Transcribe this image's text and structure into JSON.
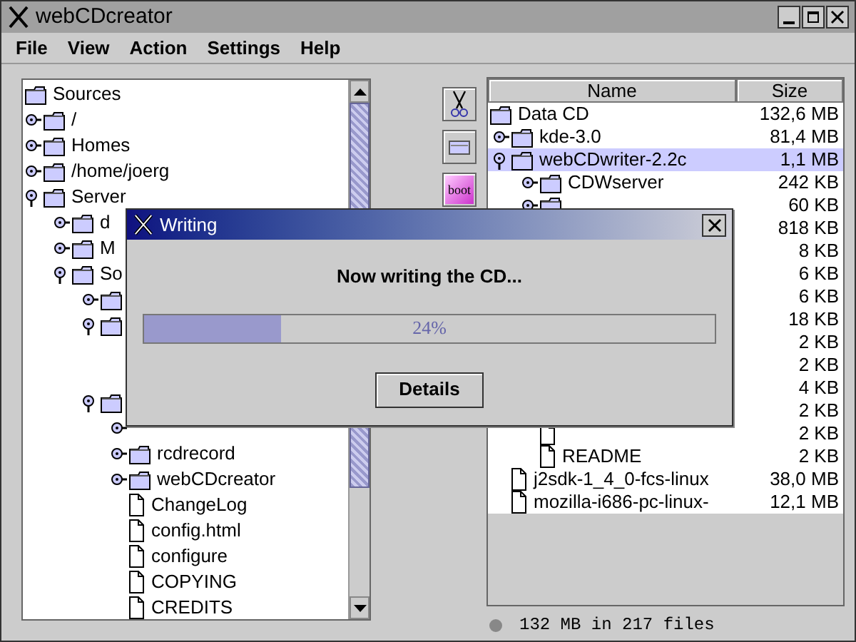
{
  "window": {
    "title": "webCDcreator"
  },
  "menu": [
    "File",
    "View",
    "Action",
    "Settings",
    "Help"
  ],
  "source_tree": [
    {
      "kind": "folder",
      "label": "Sources",
      "children": [
        {
          "kind": "folder",
          "label": "/",
          "expanded": false
        },
        {
          "kind": "folder",
          "label": "Homes",
          "expanded": false
        },
        {
          "kind": "folder",
          "label": "/home/joerg",
          "expanded": false
        },
        {
          "kind": "folder",
          "label": "Server",
          "expanded": true,
          "children": [
            {
              "kind": "folder",
              "label": "d",
              "expanded": false
            },
            {
              "kind": "folder",
              "label": "M",
              "expanded": false
            },
            {
              "kind": "folder",
              "label": "So",
              "expanded": true,
              "children": [
                {
                  "kind": "folder",
                  "expanded": false
                },
                {
                  "kind": "folder",
                  "expanded": true
                },
                {
                  "kind": "folder",
                  "expanded": true,
                  "children": [
                    {
                      "expanded": false
                    },
                    {
                      "kind": "folder",
                      "label": "rcdrecord",
                      "expanded": false
                    },
                    {
                      "kind": "folder",
                      "label": "webCDcreator",
                      "expanded": false
                    },
                    {
                      "kind": "file",
                      "label": "ChangeLog"
                    },
                    {
                      "kind": "file",
                      "label": "config.html"
                    },
                    {
                      "kind": "file",
                      "label": "configure"
                    },
                    {
                      "kind": "file",
                      "label": "COPYING"
                    },
                    {
                      "kind": "file",
                      "label": "CREDITS"
                    }
                  ]
                }
              ]
            }
          ]
        }
      ]
    }
  ],
  "toolbar": [
    {
      "kind": "scissors"
    },
    {
      "kind": "drive"
    },
    {
      "kind": "boot",
      "label": "boot"
    }
  ],
  "cd_table": {
    "columns": [
      "Name",
      "Size"
    ],
    "rows": [
      {
        "kind": "folder",
        "name": "Data CD",
        "size": "132,6 MB",
        "selected": false,
        "children": [
          {
            "kind": "folder",
            "name": "kde-3.0",
            "size": "81,4 MB",
            "expanded": false,
            "selected": false
          },
          {
            "kind": "folder",
            "name": "webCDwriter-2.2c",
            "size": "1,1 MB",
            "expanded": true,
            "selected": true,
            "children": [
              {
                "kind": "folder",
                "name": "CDWserver",
                "size": "242 KB",
                "expanded": false,
                "selected": false
              },
              {
                "kind": "folder",
                "size": "60 KB",
                "expanded": false,
                "selected": false
              },
              {
                "size": "818 KB",
                "selected": false
              },
              {
                "size": "8 KB",
                "selected": false
              },
              {
                "size": "6 KB",
                "selected": false
              },
              {
                "size": "6 KB",
                "selected": false
              },
              {
                "size": "18 KB",
                "selected": false
              },
              {
                "size": "2 KB",
                "selected": false
              },
              {
                "size": "2 KB",
                "selected": false
              },
              {
                "size": "4 KB",
                "selected": false
              },
              {
                "size": "2 KB",
                "selected": false
              },
              {
                "kind": "file",
                "size": "2 KB",
                "selected": false
              },
              {
                "kind": "file",
                "name": "README",
                "size": "2 KB",
                "selected": false
              }
            ]
          },
          {
            "kind": "file",
            "name": "j2sdk-1_4_0-fcs-linux",
            "size": "38,0 MB",
            "selected": false
          },
          {
            "kind": "file",
            "name": "mozilla-i686-pc-linux-",
            "size": "12,1 MB",
            "selected": false
          }
        ]
      }
    ]
  },
  "status": "132 MB in 217 files",
  "dialog": {
    "title": "Writing",
    "message": "Now writing the CD...",
    "progress": {
      "level": 0.24,
      "reading": "24%"
    },
    "button": "Details"
  }
}
